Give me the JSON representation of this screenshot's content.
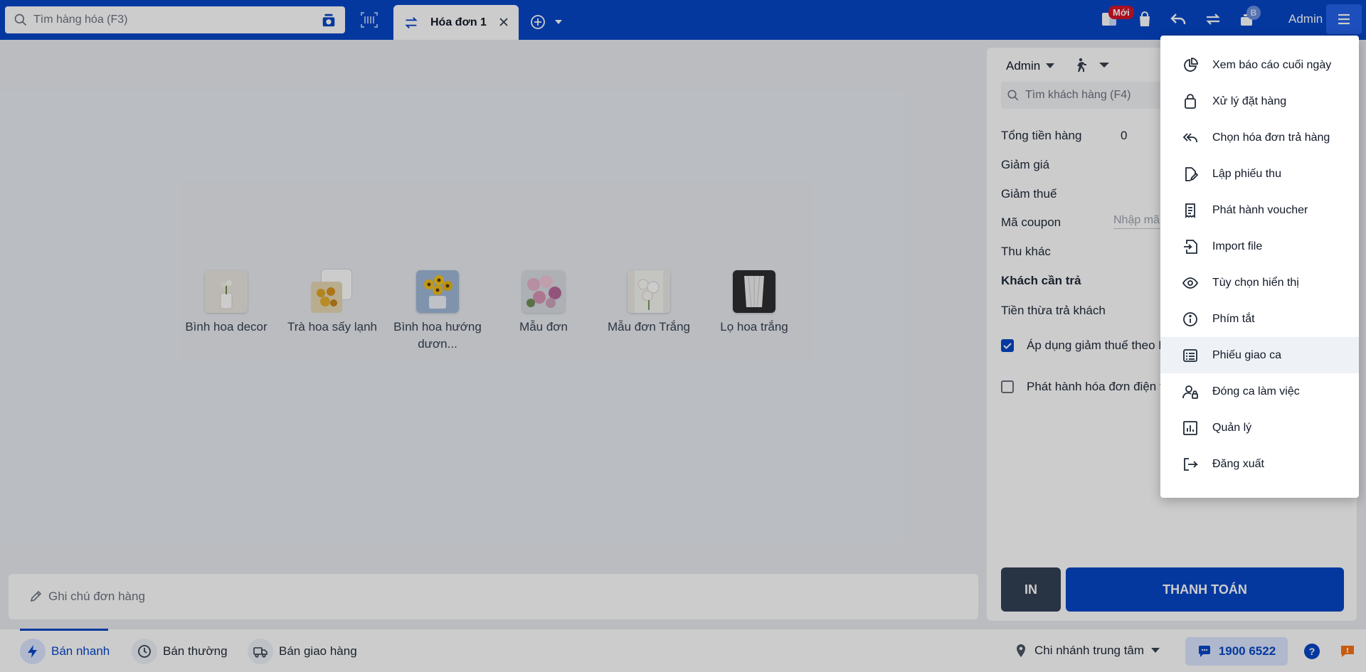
{
  "topbar": {
    "search_placeholder": "Tìm hàng hóa (F3)",
    "tab_label": "Hóa đơn 1",
    "new_badge": "Mới",
    "count_badge": "B",
    "user": "Admin"
  },
  "products": [
    {
      "name": "Bình hoa decor"
    },
    {
      "name": "Trà hoa sấy lạnh"
    },
    {
      "name": "Bình hoa hướng dươn..."
    },
    {
      "name": "Mẫu đơn"
    },
    {
      "name": "Mẫu đơn Trắng"
    },
    {
      "name": "Lọ hoa trắng"
    }
  ],
  "note": {
    "placeholder": "Ghi chú đơn hàng"
  },
  "panel": {
    "seller": "Admin",
    "customer_search_placeholder": "Tìm khách hàng (F4)",
    "rows": {
      "total_label": "Tổng tiền hàng",
      "total_value": "0",
      "discount_label": "Giảm giá",
      "tax_discount_label": "Giảm thuế",
      "coupon_label": "Mã coupon",
      "coupon_placeholder": "Nhập mã",
      "other_label": "Thu khác",
      "customer_pay_label": "Khách cần trả",
      "change_label": "Tiền thừa trả khách"
    },
    "checkbox_apply_tax": {
      "label": "Áp dụng giảm thuế theo N",
      "checked": true
    },
    "checkbox_einvoice": {
      "label": "Phát hành hóa đơn điện t",
      "checked": false
    },
    "print_label": "IN",
    "pay_label": "THANH TOÁN"
  },
  "menu": {
    "items": [
      {
        "label": "Xem báo cáo cuối ngày",
        "icon": "pie-chart-icon"
      },
      {
        "label": "Xử lý đặt hàng",
        "icon": "shopping-bag-icon"
      },
      {
        "label": "Chọn hóa đơn trả hàng",
        "icon": "reply-all-icon"
      },
      {
        "label": "Lập phiếu thu",
        "icon": "file-edit-icon"
      },
      {
        "label": "Phát hành voucher",
        "icon": "receipt-icon"
      },
      {
        "label": "Import file",
        "icon": "file-import-icon"
      },
      {
        "label": "Tùy chọn hiển thị",
        "icon": "eye-icon"
      },
      {
        "label": "Phím tắt",
        "icon": "info-icon"
      },
      {
        "label": "Phiếu giao ca",
        "icon": "list-icon"
      },
      {
        "label": "Đóng ca làm việc",
        "icon": "user-lock-icon"
      },
      {
        "label": "Quản lý",
        "icon": "bar-chart-icon"
      },
      {
        "label": "Đăng xuất",
        "icon": "logout-icon"
      }
    ],
    "highlighted": "Phiếu giao ca"
  },
  "bottombar": {
    "modes": [
      {
        "label": "Bán nhanh",
        "icon": "bolt-icon",
        "active": true
      },
      {
        "label": "Bán thường",
        "icon": "clock-icon",
        "active": false
      },
      {
        "label": "Bán giao hàng",
        "icon": "truck-icon",
        "active": false
      }
    ],
    "branch": "Chi nhánh trung tâm",
    "hotline": "1900 6522"
  },
  "colors": {
    "brand": "#0747c7",
    "dark_button": "#334155",
    "new_badge": "#d4152b"
  }
}
